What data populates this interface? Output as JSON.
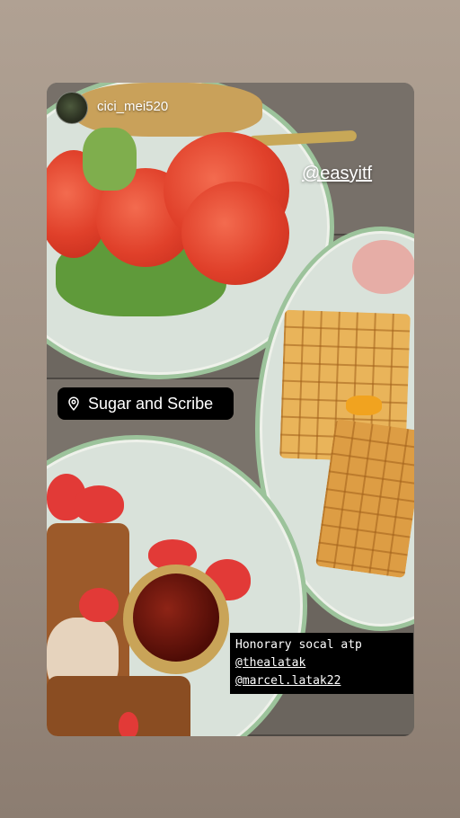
{
  "post": {
    "username": "cici_mei520",
    "mention_tag": "@easyitf",
    "location": "Sugar and Scribe",
    "caption": {
      "line1": "Honorary socal atp",
      "mention1": "@thealatak",
      "mention2": "@marcel.latak22"
    }
  },
  "icons": {
    "location": "location-pin-icon",
    "avatar": "profile-avatar"
  },
  "colors": {
    "location_bg": "#000000",
    "caption_bg": "#000000",
    "text": "#ffffff"
  }
}
